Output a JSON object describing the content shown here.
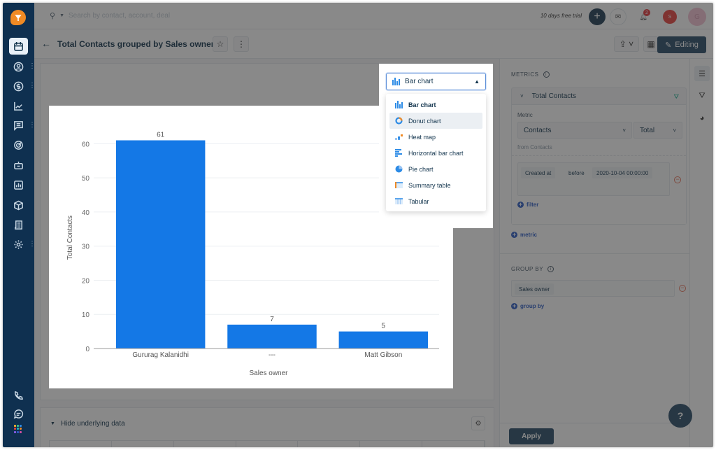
{
  "topbar": {
    "search_placeholder": "Search by contact, account, deal",
    "trial_text": "10 days free trial",
    "notification_count": "2",
    "user_badge": "S",
    "avatar_initial": "G"
  },
  "header": {
    "title": "Total Contacts grouped by Sales owner",
    "editing_label": "Editing"
  },
  "sidebar": {
    "items": [
      {
        "icon": "calendar-icon",
        "active": true,
        "has_more": false
      },
      {
        "icon": "contact-icon",
        "active": false,
        "has_more": true
      },
      {
        "icon": "dollar-icon",
        "active": false,
        "has_more": true
      },
      {
        "icon": "trend-icon",
        "active": false,
        "has_more": false
      },
      {
        "icon": "chat-icon",
        "active": false,
        "has_more": true
      },
      {
        "icon": "target-icon",
        "active": false,
        "has_more": false
      },
      {
        "icon": "bot-icon",
        "active": false,
        "has_more": false
      },
      {
        "icon": "reports-icon",
        "active": false,
        "has_more": false
      },
      {
        "icon": "product-icon",
        "active": false,
        "has_more": false
      },
      {
        "icon": "document-icon",
        "active": false,
        "has_more": false
      },
      {
        "icon": "settings-icon",
        "active": false,
        "has_more": true
      }
    ],
    "bottom": [
      "phone-icon",
      "chat-bubble-icon",
      "apps-grid-icon"
    ]
  },
  "chart_type_select": {
    "selected": "Bar chart",
    "options": [
      {
        "label": "Bar chart",
        "icon": "bar-chart-icon",
        "selected": true,
        "hover": false
      },
      {
        "label": "Donut chart",
        "icon": "donut-chart-icon",
        "selected": false,
        "hover": true
      },
      {
        "label": "Heat map",
        "icon": "heat-map-icon",
        "selected": false,
        "hover": false
      },
      {
        "label": "Horizontal bar chart",
        "icon": "horizontal-bar-icon",
        "selected": false,
        "hover": false
      },
      {
        "label": "Pie chart",
        "icon": "pie-chart-icon",
        "selected": false,
        "hover": false
      },
      {
        "label": "Summary table",
        "icon": "summary-table-icon",
        "selected": false,
        "hover": false
      },
      {
        "label": "Tabular",
        "icon": "tabular-icon",
        "selected": false,
        "hover": false
      }
    ]
  },
  "chart_data": {
    "type": "bar",
    "title": "",
    "categories": [
      "Gururag Kalanidhi",
      "---",
      "Matt Gibson"
    ],
    "values": [
      61,
      7,
      5
    ],
    "xlabel": "Sales owner",
    "ylabel": "Total Contacts",
    "ylim": [
      0,
      65
    ],
    "yticks": [
      0,
      10,
      20,
      30,
      40,
      50,
      60
    ],
    "grid": true,
    "bar_color": "#1478e6",
    "data_labels": true
  },
  "underlying": {
    "toggle_label": "Hide underlying data"
  },
  "right_panel": {
    "metrics_label": "METRICS",
    "metric_name": "Total Contacts",
    "metric_field_label": "Metric",
    "metric_value": "Contacts",
    "aggregate_value": "Total",
    "from_label": "from Contacts",
    "filter": {
      "field": "Created at",
      "operator": "before",
      "value": "2020-10-04 00:00:00"
    },
    "add_filter_label": "filter",
    "add_metric_label": "metric",
    "group_by_label": "GROUP BY",
    "group_by_value": "Sales owner",
    "add_group_by_label": "group by",
    "apply_label": "Apply",
    "help_label": "?"
  },
  "colors": {
    "sidebar": "#0f3050",
    "accent": "#264966",
    "bar": "#1478e6",
    "link": "#2c5cc5",
    "danger": "#e8735c"
  }
}
